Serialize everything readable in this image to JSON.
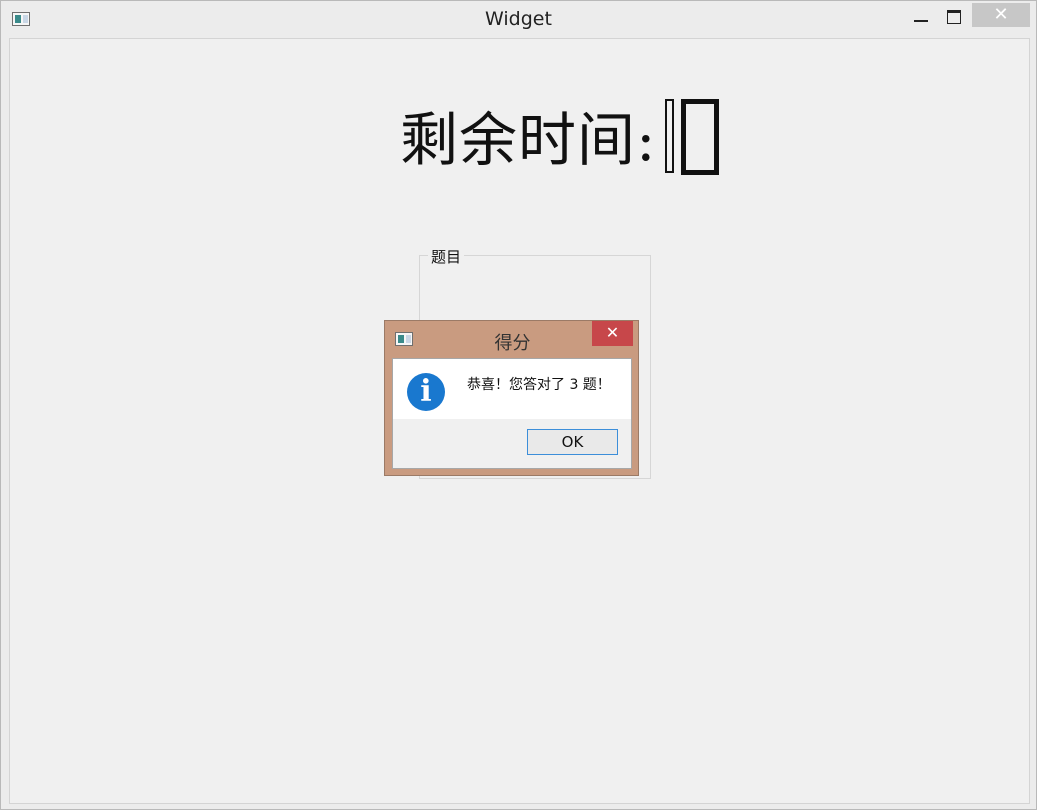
{
  "window": {
    "title": "Widget",
    "close_glyph": "✕",
    "icons": [
      "app-icon",
      "minimize-icon",
      "maximize-icon",
      "close-icon"
    ]
  },
  "timer": {
    "label": "剩余时间:",
    "value": "10"
  },
  "group": {
    "title": "题目"
  },
  "dialog": {
    "title": "得分",
    "close_glyph": "✕",
    "icon_glyph": "i",
    "message": "恭喜！您答对了 3 题！",
    "ok_label": "OK",
    "icons": [
      "app-icon",
      "information-icon",
      "close-icon"
    ]
  },
  "colors": {
    "dialog_frame": "#c99b80",
    "dialog_close": "#c7474a",
    "info_icon": "#1978cf",
    "ok_border": "#3c8ed9"
  }
}
